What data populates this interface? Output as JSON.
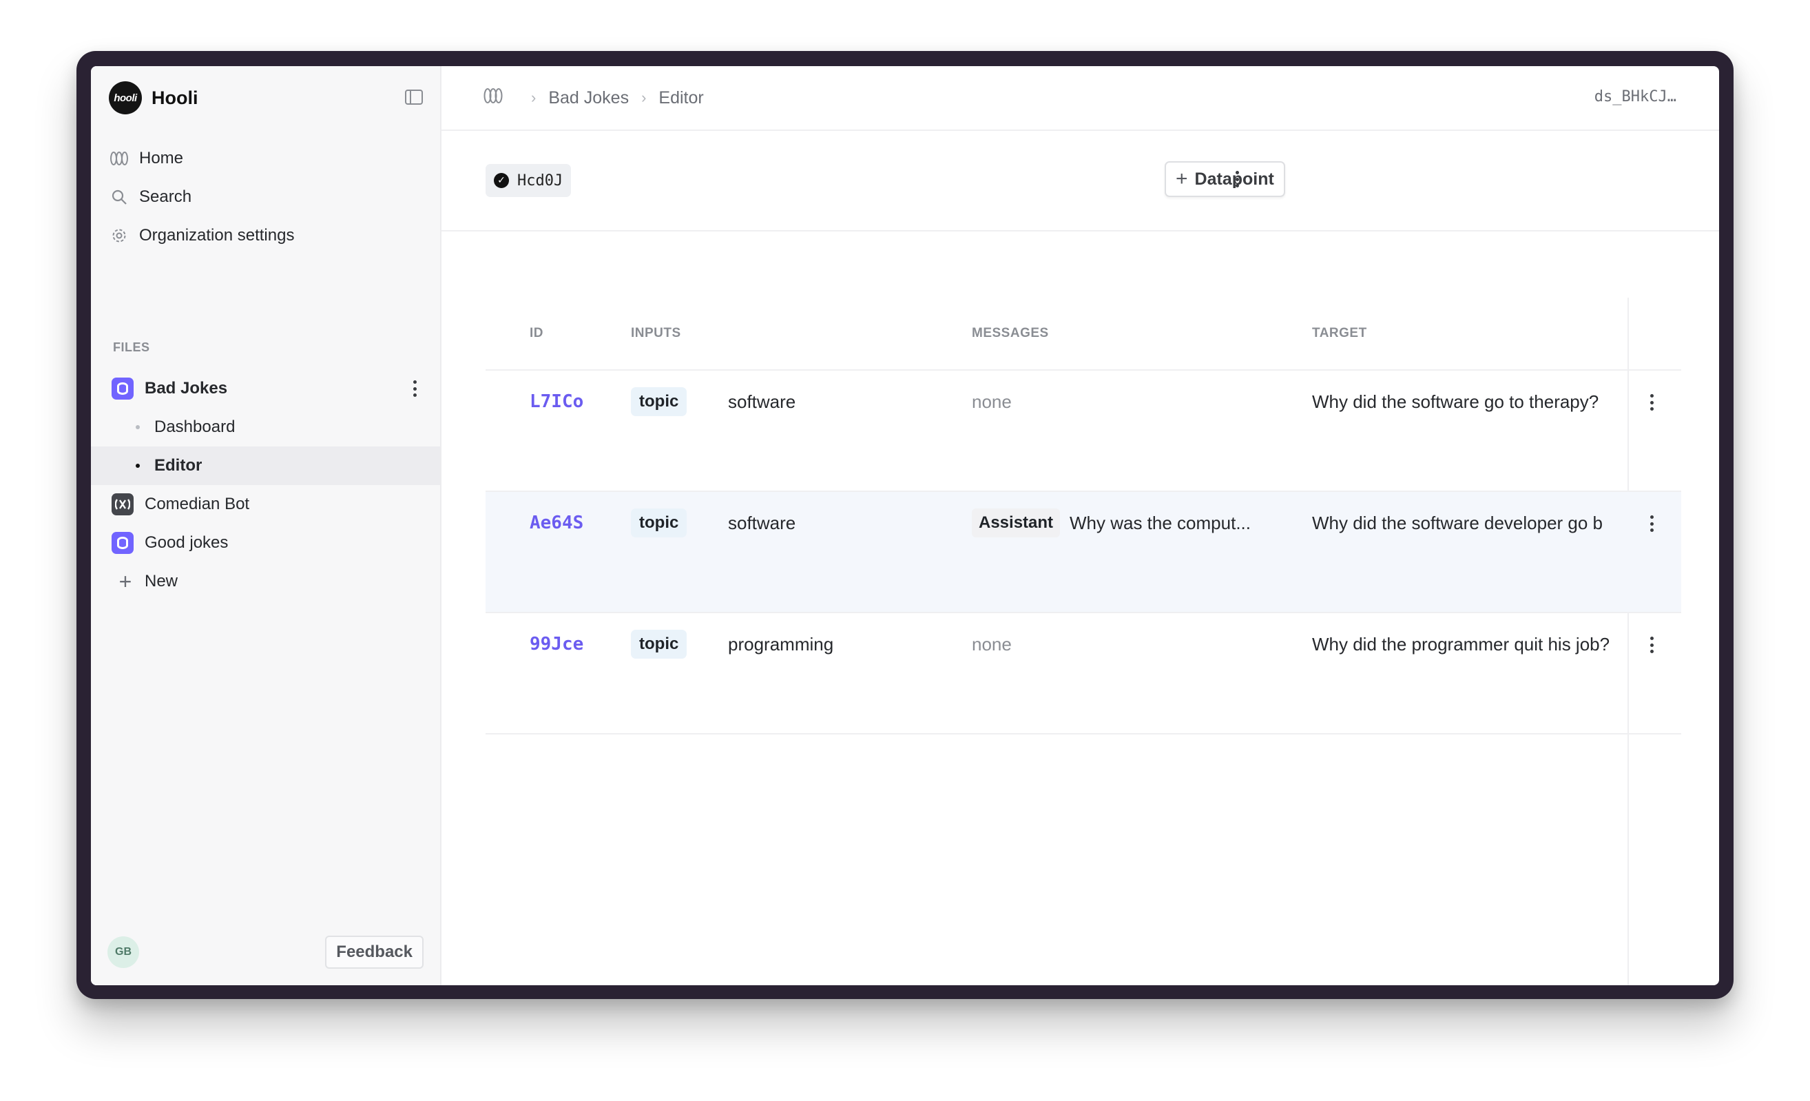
{
  "brand": {
    "name": "Hooli",
    "logo_text": "hooli"
  },
  "nav": [
    {
      "label": "Home",
      "icon": "hooli-mark-icon"
    },
    {
      "label": "Search",
      "icon": "search-icon"
    },
    {
      "label": "Organization settings",
      "icon": "gear-icon"
    }
  ],
  "files": {
    "section_title": "FILES",
    "items": [
      {
        "label": "Bad Jokes",
        "type": "dataset"
      },
      {
        "label": "Dashboard",
        "type": "child"
      },
      {
        "label": "Editor",
        "type": "child",
        "active": true
      },
      {
        "label": "Comedian Bot",
        "type": "prompt"
      },
      {
        "label": "Good jokes",
        "type": "dataset"
      },
      {
        "label": "New",
        "type": "new"
      }
    ]
  },
  "footer": {
    "avatar_initials": "GB",
    "feedback_label": "Feedback"
  },
  "breadcrumb": {
    "items": [
      "Bad Jokes",
      "Editor"
    ]
  },
  "dataset_id": "ds_BHkCJ…",
  "toolbar": {
    "version_label": "Hcd0J",
    "add_datapoint_label": "Datapoint"
  },
  "table": {
    "headers": {
      "id": "ID",
      "inputs": "INPUTS",
      "messages": "MESSAGES",
      "target": "TARGET"
    },
    "rows": [
      {
        "id": "L7ICo",
        "input_key": "topic",
        "input_value": "software",
        "messages": "none",
        "target": "Why did the software go to therapy?"
      },
      {
        "id": "Ae64S",
        "input_key": "topic",
        "input_value": "software",
        "message_role": "Assistant",
        "message_text": "Why was the comput...",
        "target": "Why did the software developer go b"
      },
      {
        "id": "99Jce",
        "input_key": "topic",
        "input_value": "programming",
        "messages": "none",
        "target": "Why did the programmer quit his job?"
      }
    ]
  },
  "colors": {
    "accent": "#7164ff",
    "id_text": "#6b5cf0",
    "hover_row": "#f4f7fc"
  }
}
